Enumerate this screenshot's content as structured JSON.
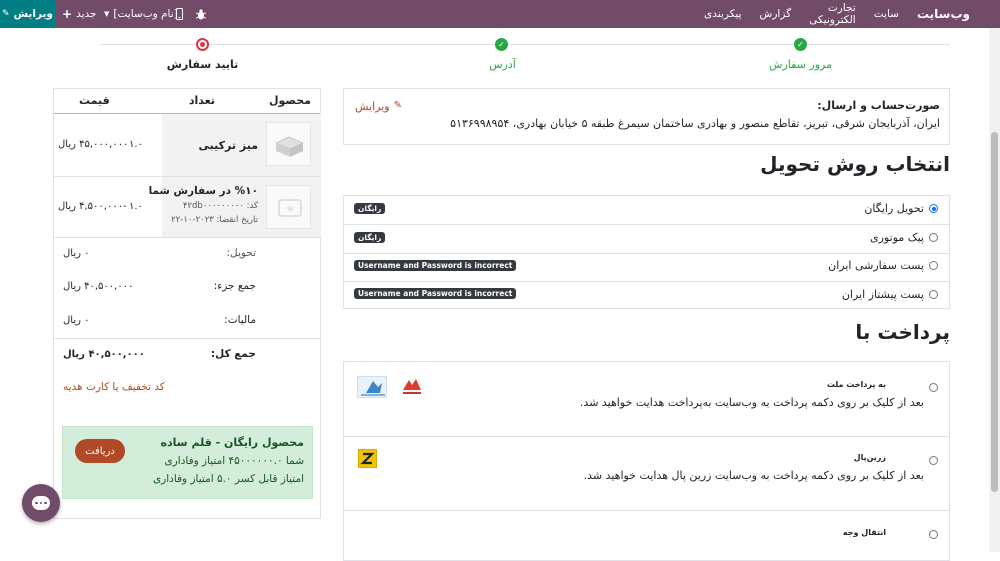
{
  "topbar": {
    "edit_label": "ویرایش",
    "new_label": "جدید",
    "website_select": "[نام وب‌سایت]",
    "brand": "وب‌سایت",
    "menu": [
      "سایت",
      "تجارت الکترونیکی",
      "گزارش",
      "پیکربندی"
    ]
  },
  "progress": {
    "steps": [
      {
        "label": "مرور سفارش",
        "state": "done"
      },
      {
        "label": "آدرس",
        "state": "done"
      },
      {
        "label": "تایید سفارش",
        "state": "current"
      }
    ]
  },
  "address": {
    "title": "صورت‌حساب و ارسال:",
    "line": "ایران، آذربایجان شرقی، تبریز، تقاطع منصور و بهادری ساختمان سیمرغ طبقه ۵ خیابان بهادری، ۵۱۳۶۹۹۸۹۵۴",
    "edit_label": "ویرایش"
  },
  "shipping": {
    "heading": "انتخاب روش تحویل",
    "methods": [
      {
        "name": "تحویل رایگان",
        "badge": "رایگان",
        "selected": true
      },
      {
        "name": "پیک موتوری",
        "badge": "رایگان",
        "selected": false
      },
      {
        "name": "پست سفارشی ایران",
        "badge": "Username and Password is incorrect",
        "selected": false
      },
      {
        "name": "پست پیشتاز ایران",
        "badge": "Username and Password is incorrect",
        "selected": false
      }
    ]
  },
  "payment": {
    "heading": "پرداخت با",
    "providers": [
      {
        "name": "به پرداخت ملت",
        "desc": "بعد از کلیک بر روی دکمه پرداخت به وب‌سایت به‌پرداخت هدایت خواهید شد."
      },
      {
        "name": "زرین‌پال",
        "desc": "بعد از کلیک بر روی دکمه پرداخت به وب‌سایت زرین پال هدایت خواهید شد."
      },
      {
        "name": "انتقال وجه",
        "desc": ""
      }
    ]
  },
  "cart": {
    "headers": {
      "product": "محصول",
      "qty": "تعداد",
      "price": "قیمت"
    },
    "lines": [
      {
        "name": "میز ترکیبی",
        "code": "",
        "expiry": "",
        "qty": "۱.۰",
        "price": "۴۵,۰۰۰,۰۰۰ ریال"
      },
      {
        "name": "%۱۰ در سفارش شما",
        "code": "کد: ۴۲db۰۰۰۰۰۰۰۰۰",
        "expiry": "تاریخ انقضا: ۲۰۲۳-۱۰-۲۲",
        "qty": "۱.۰",
        "price": "-۴,۵۰۰,۰۰۰ ریال"
      }
    ],
    "totals": [
      {
        "label": "تحویل:",
        "value": "۰ ریال"
      },
      {
        "label": "جمع جزء:",
        "value": "۴۰,۵۰۰,۰۰۰ ریال"
      },
      {
        "label": "مالیات:",
        "value": "۰ ریال"
      }
    ],
    "grand_total": {
      "label": "جمع کل:",
      "value": "۴۰,۵۰۰,۰۰۰ ریال"
    },
    "coupon_link": "کد تخفیف یا کارت هدیه",
    "reward": {
      "title": "محصول رایگان - قلم ساده",
      "line1": "شما ۴۵۰۰۰۰۰۰.۰ امتیاز وفاداری",
      "line2": "امتیاز قابل کسر ۵.۰ امتیاز وفاداری",
      "button": "دریافت"
    }
  },
  "colors": {
    "topbar": "#714b67",
    "edit_button": "#017e84",
    "success": "#28a745",
    "danger": "#dc3545",
    "link": "#b04a26",
    "reward_bg": "#d4edda"
  }
}
